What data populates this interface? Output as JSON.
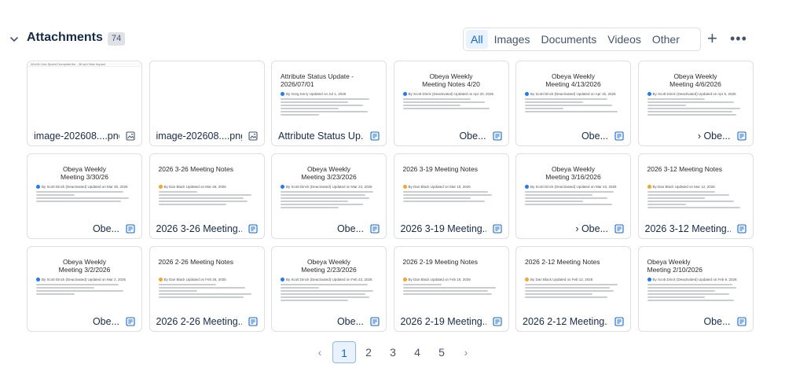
{
  "header": {
    "title": "Attachments",
    "count": "74",
    "filters": [
      "All",
      "Images",
      "Documents",
      "Videos",
      "Other"
    ],
    "active_filter": "All"
  },
  "cards": [
    {
      "kind": "image",
      "label": "image-202608....png",
      "strip": "WLAN Line-Speed Dumpsterfire - 36 kph New Impact"
    },
    {
      "kind": "image",
      "label": "image-202608....png",
      "strip": ""
    },
    {
      "kind": "doc",
      "title": "Attribute Status Update -\n2026/07/01",
      "title_align": "left",
      "meta": "By Greg Kerry Updated on Jul 1, 2026",
      "label": "Attribute Status Up...",
      "label_align": "left"
    },
    {
      "kind": "doc",
      "title": "Obeya Weekly\nMeeting Notes 4/20",
      "title_align": "center",
      "meta": "By Scott Dinck (Deactivated) Updated on Apr 20, 2026",
      "label": "Obe...",
      "label_align": "right"
    },
    {
      "kind": "doc",
      "title": "Obeya Weekly\nMeeting 4/13/2026",
      "title_align": "center",
      "meta": "By Scott Dinck (Deactivated) Updated on Apr 15, 2026",
      "label": "Obe...",
      "label_align": "right"
    },
    {
      "kind": "doc",
      "title": "Obeya Weekly\nMeeting 4/6/2026",
      "title_align": "center",
      "meta": "By Scott Dinck (Deactivated) Updated on Apr 6, 2026",
      "label": "› Obe...",
      "label_align": "right"
    },
    {
      "kind": "doc",
      "title": "Obeya Weekly\nMeeting 3/30/26",
      "title_align": "center",
      "meta": "By Scott Dinck (Deactivated) Updated on Mar 30, 2026",
      "label": "Obe...",
      "label_align": "right"
    },
    {
      "kind": "doc",
      "title": "2026 3-26 Meeting Notes",
      "title_align": "left",
      "meta": "By Dan Black Updated on Mar 26, 2026",
      "label": "2026 3-26 Meeting...",
      "label_align": "left",
      "dot": "#f5a623"
    },
    {
      "kind": "doc",
      "title": "Obeya Weekly\nMeeting 3/23/2026",
      "title_align": "center",
      "meta": "By Scott Dinck (Deactivated) Updated on Mar 23, 2026",
      "label": "Obe...",
      "label_align": "right"
    },
    {
      "kind": "doc",
      "title": "2026 3-19 Meeting Notes",
      "title_align": "left",
      "meta": "By Dan Black Updated on Mar 19, 2026",
      "label": "2026 3-19 Meeting...",
      "label_align": "left",
      "dot": "#f5a623"
    },
    {
      "kind": "doc",
      "title": "Obeya Weekly\nMeeting 3/16/2026",
      "title_align": "center",
      "meta": "By Scott Dinck (Deactivated) Updated on Mar 23, 2026",
      "label": "› Obe...",
      "label_align": "right"
    },
    {
      "kind": "doc",
      "title": "2026 3-12 Meeting Notes",
      "title_align": "left",
      "meta": "By Dan Black Updated on Mar 12, 2026",
      "label": "2026 3-12 Meeting...",
      "label_align": "left",
      "dot": "#f5a623"
    },
    {
      "kind": "doc",
      "title": "Obeya Weekly\nMeeting 3/2/2026",
      "title_align": "center",
      "meta": "By Scott Dinck (Deactivated) Updated on Mar 2, 2026",
      "label": "Obe...",
      "label_align": "right"
    },
    {
      "kind": "doc",
      "title": "2026 2-26 Meeting Notes",
      "title_align": "left",
      "meta": "By Dan Black Updated on Feb 26, 2026",
      "label": "2026 2-26 Meeting...",
      "label_align": "left",
      "dot": "#f5a623"
    },
    {
      "kind": "doc",
      "title": "Obeya Weekly\nMeeting 2/23/2026",
      "title_align": "center",
      "meta": "By Scott Dinck (Deactivated) Updated on Feb 23, 2026",
      "label": "Obe...",
      "label_align": "right"
    },
    {
      "kind": "doc",
      "title": "2026 2-19 Meeting Notes",
      "title_align": "left",
      "meta": "By Dan Black Updated on Feb 19, 2026",
      "label": "2026 2-19 Meeting...",
      "label_align": "left",
      "dot": "#f5a623"
    },
    {
      "kind": "doc",
      "title": "2026 2-12 Meeting Notes",
      "title_align": "left",
      "meta": "By Dan Black Updated on Feb 12, 2026",
      "label": "2026 2-12 Meeting...",
      "label_align": "left",
      "dot": "#f5a623"
    },
    {
      "kind": "doc",
      "title": "Obeya Weekly\nMeeting 2/10/2026",
      "title_align": "left",
      "meta": "By Scott Dinck (Deactivated) Updated on Feb 9, 2026",
      "label": "Obe...",
      "label_align": "right"
    }
  ],
  "pagination": {
    "pages": [
      "1",
      "2",
      "3",
      "4",
      "5"
    ],
    "current": "1",
    "prev": "‹",
    "next": "›"
  },
  "colors": {
    "accent": "#0c66e4",
    "active_bg": "#e9f2ff",
    "doc_icon": "#0c66e4",
    "meta_dot_default": "#1d7afc"
  },
  "icons": {
    "collapse": "chevron-down-icon",
    "add": "plus-icon",
    "more": "more-horizontal-icon",
    "image_file": "image-file-icon",
    "page_file": "page-file-icon"
  }
}
